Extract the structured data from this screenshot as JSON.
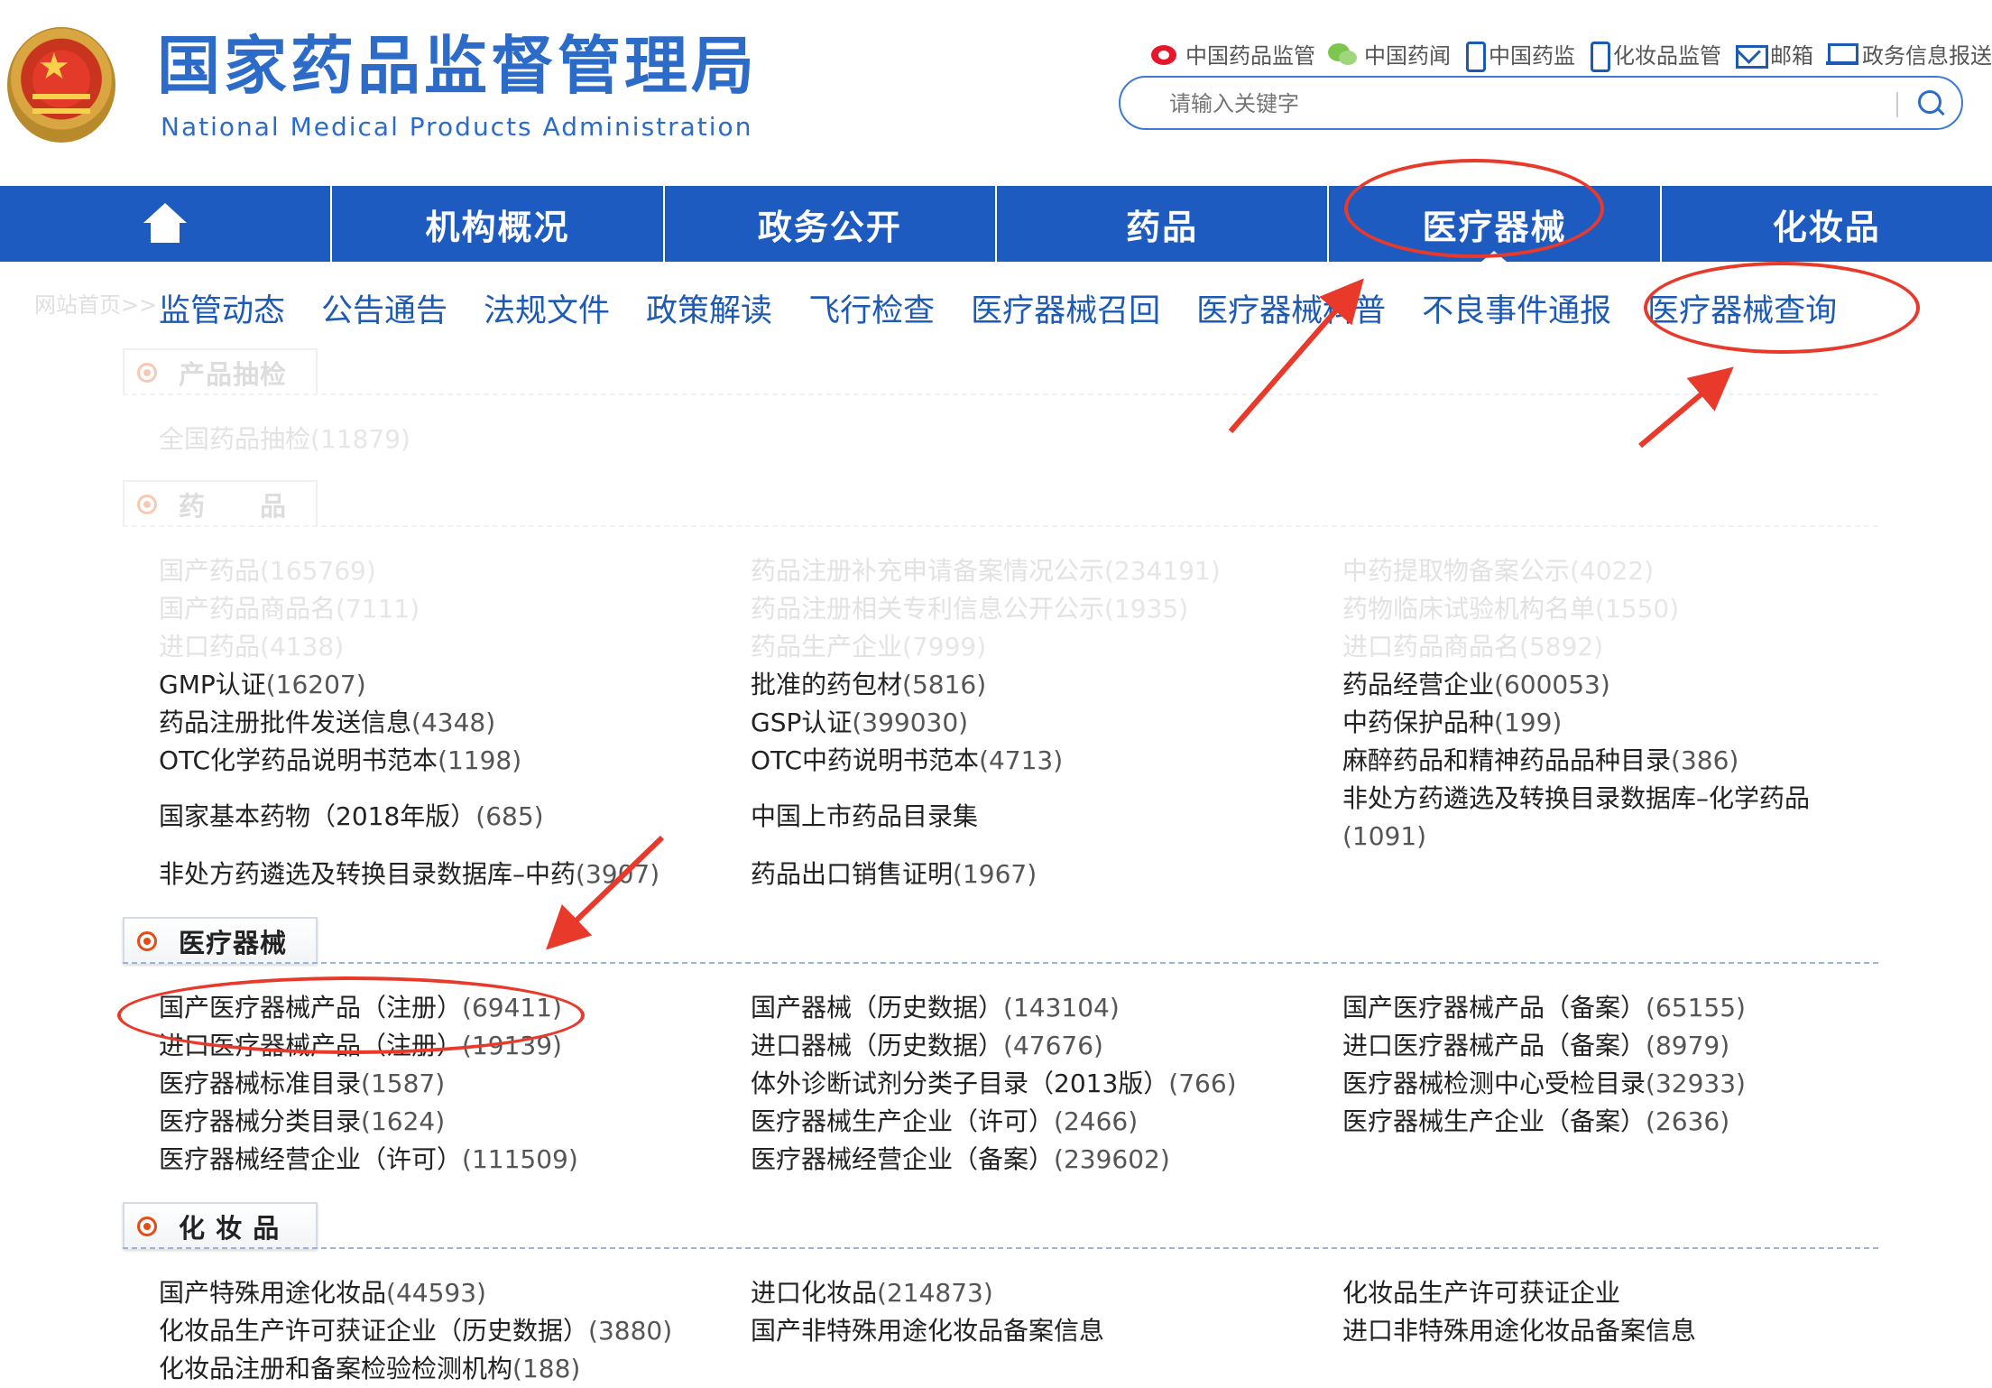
{
  "header": {
    "title": "国家药品监督管理局",
    "subtitle": "National Medical Products Administration",
    "top_links": [
      {
        "icon": "weibo-icon",
        "label": "中国药品监管"
      },
      {
        "icon": "wechat-icon",
        "label": "中国药闻"
      },
      {
        "icon": "phone-icon",
        "label": "中国药监"
      },
      {
        "icon": "phone-icon",
        "label": "化妆品监管"
      },
      {
        "icon": "mail-icon",
        "label": "邮箱"
      },
      {
        "icon": "report-icon",
        "label": "政务信息报送"
      }
    ],
    "search": {
      "placeholder": "请输入关键字"
    }
  },
  "main_nav": {
    "items": [
      "机构概况",
      "政务公开",
      "药品",
      "医疗器械",
      "化妆品"
    ],
    "active": "医疗器械"
  },
  "breadcrumb": "网站首页>>",
  "sub_nav": [
    "监管动态",
    "公告通告",
    "法规文件",
    "政策解读",
    "飞行检查",
    "医疗器械召回",
    "医疗器械科普",
    "不良事件通报",
    "医疗器械查询"
  ],
  "sections": {
    "spot_check": {
      "title": "产品抽检",
      "links": [
        {
          "label": "全国药品抽检",
          "count": "(11879)"
        }
      ]
    },
    "drugs": {
      "title": "药　　品",
      "col1": [
        {
          "label": "国产药品",
          "count": "(165769)"
        },
        {
          "label": "国产药品商品名",
          "count": "(7111)"
        },
        {
          "label": "进口药品",
          "count": "(4138)"
        },
        {
          "label": "GMP认证",
          "count": "(16207)"
        },
        {
          "label": "药品注册批件发送信息",
          "count": "(4348)"
        },
        {
          "label": "OTC化学药品说明书范本",
          "count": "(1198)"
        },
        {
          "label": "国家基本药物（2018年版）",
          "count": "(685)"
        },
        {
          "label": "非处方药遴选及转换目录数据库–中药",
          "count": "(3907)"
        }
      ],
      "col2": [
        {
          "label": "药品注册补充申请备案情况公示",
          "count": "(234191)"
        },
        {
          "label": "药品注册相关专利信息公开公示",
          "count": "(1935)"
        },
        {
          "label": "药品生产企业",
          "count": "(7999)"
        },
        {
          "label": "批准的药包材",
          "count": "(5816)"
        },
        {
          "label": "GSP认证",
          "count": "(399030)"
        },
        {
          "label": "OTC中药说明书范本",
          "count": "(4713)"
        },
        {
          "label": "中国上市药品目录集",
          "count": ""
        },
        {
          "label": "药品出口销售证明",
          "count": "(1967)"
        }
      ],
      "col3": [
        {
          "label": "中药提取物备案公示",
          "count": "(4022)"
        },
        {
          "label": "药物临床试验机构名单",
          "count": "(1550)"
        },
        {
          "label": "进口药品商品名",
          "count": "(5892)"
        },
        {
          "label": "药品经营企业",
          "count": "(600053)"
        },
        {
          "label": "中药保护品种",
          "count": "(199)"
        },
        {
          "label": "麻醉药品和精神药品品种目录",
          "count": "(386)"
        },
        {
          "label": "非处方药遴选及转换目录数据库–化学药品",
          "count": ""
        },
        {
          "label": "",
          "count": "(1091)"
        }
      ]
    },
    "devices": {
      "title": "医疗器械",
      "col1": [
        {
          "label": "国产医疗器械产品（注册）",
          "count": "(69411)"
        },
        {
          "label": "进口医疗器械产品（注册）",
          "count": "(19139)"
        },
        {
          "label": "医疗器械标准目录",
          "count": "(1587)"
        },
        {
          "label": "医疗器械分类目录",
          "count": "(1624)"
        },
        {
          "label": "医疗器械经营企业（许可）",
          "count": "(111509)"
        }
      ],
      "col2": [
        {
          "label": "国产器械（历史数据）",
          "count": "(143104)"
        },
        {
          "label": "进口器械（历史数据）",
          "count": "(47676)"
        },
        {
          "label": "体外诊断试剂分类子目录（2013版）",
          "count": "(766)"
        },
        {
          "label": "医疗器械生产企业（许可）",
          "count": "(2466)"
        },
        {
          "label": "医疗器械经营企业（备案）",
          "count": "(239602)"
        }
      ],
      "col3": [
        {
          "label": "国产医疗器械产品（备案）",
          "count": "(65155)"
        },
        {
          "label": "进口医疗器械产品（备案）",
          "count": "(8979)"
        },
        {
          "label": "医疗器械检测中心受检目录",
          "count": "(32933)"
        },
        {
          "label": "医疗器械生产企业（备案）",
          "count": "(2636)"
        }
      ]
    },
    "cosmetics": {
      "title": "化 妆 品",
      "col1": [
        {
          "label": "国产特殊用途化妆品",
          "count": "(44593)"
        },
        {
          "label": "化妆品生产许可获证企业（历史数据）",
          "count": "(3880)"
        },
        {
          "label": "化妆品注册和备案检验检测机构",
          "count": "(188)"
        }
      ],
      "col2": [
        {
          "label": "进口化妆品",
          "count": "(214873)"
        },
        {
          "label": "国产非特殊用途化妆品备案信息",
          "count": ""
        }
      ],
      "col3": [
        {
          "label": "化妆品生产许可获证企业",
          "count": ""
        },
        {
          "label": "进口非特殊用途化妆品备案信息",
          "count": ""
        }
      ]
    }
  },
  "colors": {
    "brand_blue": "#1d5bc1",
    "annotation_red": "#e8392b",
    "accent_orange": "#e24e16"
  }
}
